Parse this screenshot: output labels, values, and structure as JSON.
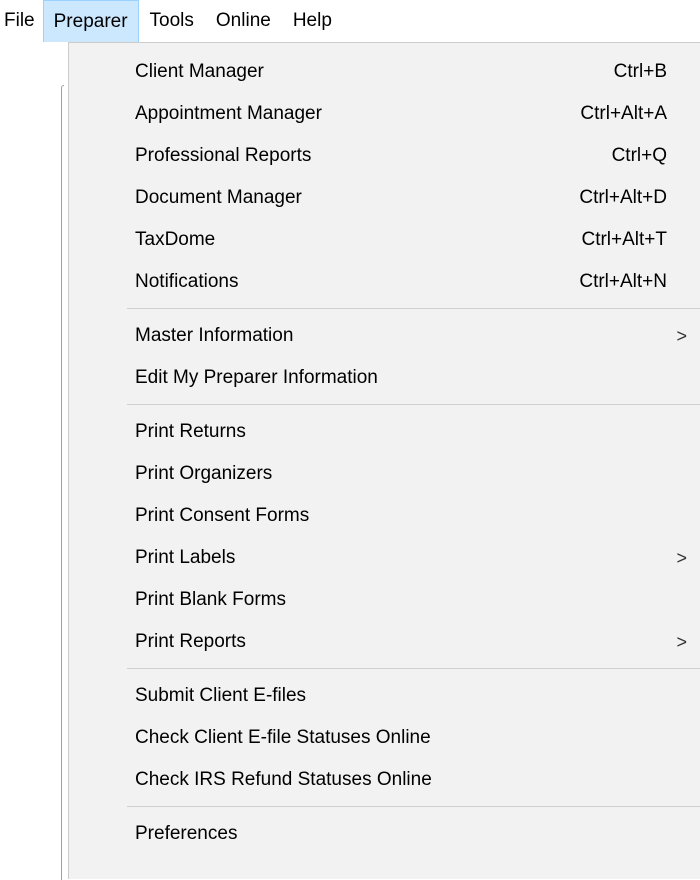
{
  "menubar": {
    "items": [
      {
        "label": "File"
      },
      {
        "label": "Preparer",
        "active": true
      },
      {
        "label": "Tools"
      },
      {
        "label": "Online"
      },
      {
        "label": "Help"
      }
    ]
  },
  "menu": {
    "groups": [
      [
        {
          "label": "Client Manager",
          "shortcut": "Ctrl+B"
        },
        {
          "label": "Appointment Manager",
          "shortcut": "Ctrl+Alt+A"
        },
        {
          "label": "Professional Reports",
          "shortcut": "Ctrl+Q"
        },
        {
          "label": "Document Manager",
          "shortcut": "Ctrl+Alt+D"
        },
        {
          "label": "TaxDome",
          "shortcut": "Ctrl+Alt+T"
        },
        {
          "label": "Notifications",
          "shortcut": "Ctrl+Alt+N"
        }
      ],
      [
        {
          "label": "Master Information",
          "submenu_arrow": ">"
        },
        {
          "label": "Edit My Preparer Information"
        }
      ],
      [
        {
          "label": "Print Returns"
        },
        {
          "label": "Print Organizers"
        },
        {
          "label": "Print Consent Forms"
        },
        {
          "label": "Print Labels",
          "submenu_arrow": ">"
        },
        {
          "label": "Print Blank Forms"
        },
        {
          "label": "Print Reports",
          "submenu_arrow": ">"
        }
      ],
      [
        {
          "label": "Submit Client E-files"
        },
        {
          "label": "Check Client E-file Statuses Online"
        },
        {
          "label": "Check IRS Refund Statuses Online"
        }
      ],
      [
        {
          "label": "Preferences"
        }
      ]
    ]
  },
  "colors": {
    "active_menu_bg": "#cce8ff",
    "active_menu_border": "#99d1ff",
    "dropdown_bg": "#f2f2f2"
  }
}
